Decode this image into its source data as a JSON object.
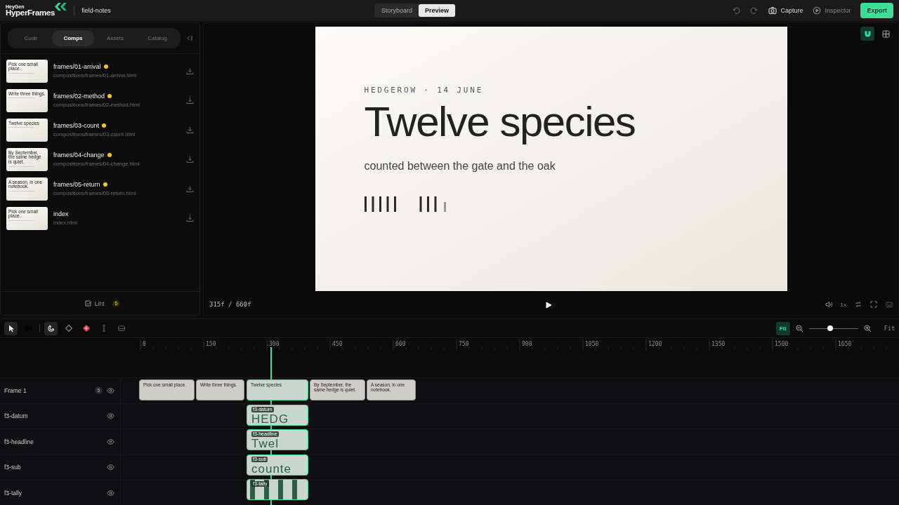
{
  "header": {
    "logo_top": "HeyGen",
    "logo_bottom": "HyperFrames",
    "project": "field-notes",
    "views": [
      {
        "label": "Storyboard",
        "selected": false
      },
      {
        "label": "Preview",
        "selected": true
      }
    ],
    "actions": [
      {
        "kind": "undo",
        "disabled": true
      },
      {
        "kind": "redo",
        "disabled": true
      },
      {
        "kind": "capture",
        "label": "Capture"
      },
      {
        "kind": "inspector",
        "label": "Inspector"
      }
    ],
    "export": "Export"
  },
  "sidebar": {
    "tabs": [
      {
        "label": "Code",
        "selected": false
      },
      {
        "label": "Comps",
        "selected": true
      },
      {
        "label": "Assets",
        "selected": false
      },
      {
        "label": "Catalog",
        "selected": false
      }
    ],
    "comps": [
      {
        "name": "frames/01-arrival",
        "path": "compositions/frames/01-arrival.html",
        "modified": true,
        "thumb_title": "Pick one small place."
      },
      {
        "name": "frames/02-method",
        "path": "compositions/frames/02-method.html",
        "modified": true,
        "thumb_title": "Write three things."
      },
      {
        "name": "frames/03-count",
        "path": "compositions/frames/03-count.html",
        "modified": true,
        "thumb_title": "Twelve species"
      },
      {
        "name": "frames/04-change",
        "path": "compositions/frames/04-change.html",
        "modified": true,
        "thumb_title": "By September, the same hedge is quiet."
      },
      {
        "name": "frames/05-return",
        "path": "compositions/frames/05-return.html",
        "modified": true,
        "thumb_title": "A season, in one notebook."
      },
      {
        "name": "index",
        "path": "index.html",
        "modified": false,
        "thumb_title": "Pick one small place."
      }
    ],
    "lint": {
      "label": "Lint",
      "count": "5"
    }
  },
  "preview": {
    "datum": "HEDGEROW · 14 JUNE",
    "headline": "Twelve species",
    "sub": "counted between the gate and the oak",
    "frame": "315f / 660f",
    "speed": "1x"
  },
  "timeline": {
    "tools": [
      {
        "kind": "select",
        "selected": true
      },
      {
        "kind": "cut",
        "selected": false
      },
      {
        "kind": "snap",
        "selected": true
      },
      {
        "kind": "keyframe",
        "selected": false
      },
      {
        "kind": "keyframe-add",
        "selected": false
      },
      {
        "kind": "text",
        "selected": false
      },
      {
        "kind": "audio",
        "selected": false
      }
    ],
    "fit_button": "Fit",
    "fit_label": "Fit",
    "zoom": {
      "level": 0.43
    },
    "ticks": [
      "0",
      "150",
      "300",
      "450",
      "600",
      "750",
      "900",
      "1050",
      "1200",
      "1350",
      "1500",
      "1650"
    ],
    "tracks": [
      {
        "name": "Frame 1",
        "count": "5",
        "clips": [
          {
            "kind": "thumb",
            "title": "Pick one small place.",
            "selected": false
          },
          {
            "kind": "thumb",
            "title": "Write three things.",
            "selected": false
          },
          {
            "kind": "thumb",
            "title": "Twelve species",
            "selected": true
          },
          {
            "kind": "thumb",
            "title": "By September, the same hedge is quiet.",
            "selected": false
          },
          {
            "kind": "thumb",
            "title": "A season, in one notebook.",
            "selected": false
          }
        ]
      },
      {
        "name": "f3-datum",
        "clips": [
          {
            "kind": "text",
            "label": "f3-datum",
            "preview": "HEDG",
            "selected": true
          }
        ]
      },
      {
        "name": "f3-headline",
        "clips": [
          {
            "kind": "text",
            "label": "f3-headline",
            "preview": "Twel",
            "selected": true
          }
        ]
      },
      {
        "name": "f3-sub",
        "clips": [
          {
            "kind": "text",
            "label": "f3-sub",
            "preview": "counte",
            "selected": true
          }
        ]
      },
      {
        "name": "f3-tally",
        "clips": [
          {
            "kind": "bars",
            "label": "f3-tally",
            "selected": true
          }
        ]
      }
    ]
  }
}
